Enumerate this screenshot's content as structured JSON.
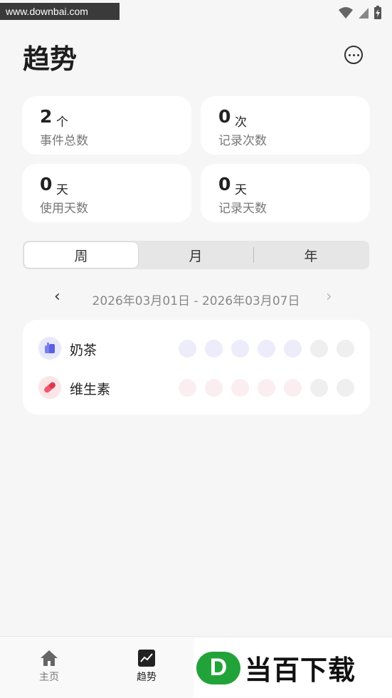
{
  "watermark": {
    "top_text": "www.downbai.com",
    "brand_logo_letter": "D",
    "brand_text": "当百下载"
  },
  "header": {
    "title": "趋势"
  },
  "stats": [
    {
      "value": "2",
      "unit": "个",
      "label": "事件总数"
    },
    {
      "value": "0",
      "unit": "次",
      "label": "记录次数"
    },
    {
      "value": "0",
      "unit": "天",
      "label": "使用天数"
    },
    {
      "value": "0",
      "unit": "天",
      "label": "记录天数"
    }
  ],
  "segment": {
    "options": [
      "周",
      "月",
      "年"
    ],
    "selected": "周"
  },
  "date_range": {
    "prev": "‹",
    "text": "2026年03月01日 - 2026年03月07日",
    "next": "›"
  },
  "events": [
    {
      "name": "奶茶",
      "icon": "milk-tea-icon",
      "color": "#7b7ff0",
      "dot_color": "#ececfb"
    },
    {
      "name": "维生素",
      "icon": "pill-icon",
      "color": "#f0576a",
      "dot_color": "#fbeef0"
    }
  ],
  "empty_dot_color": "#efefef",
  "tabs": [
    {
      "label": "主页",
      "icon": "home-icon"
    },
    {
      "label": "趋势",
      "icon": "trend-chart-icon"
    }
  ]
}
